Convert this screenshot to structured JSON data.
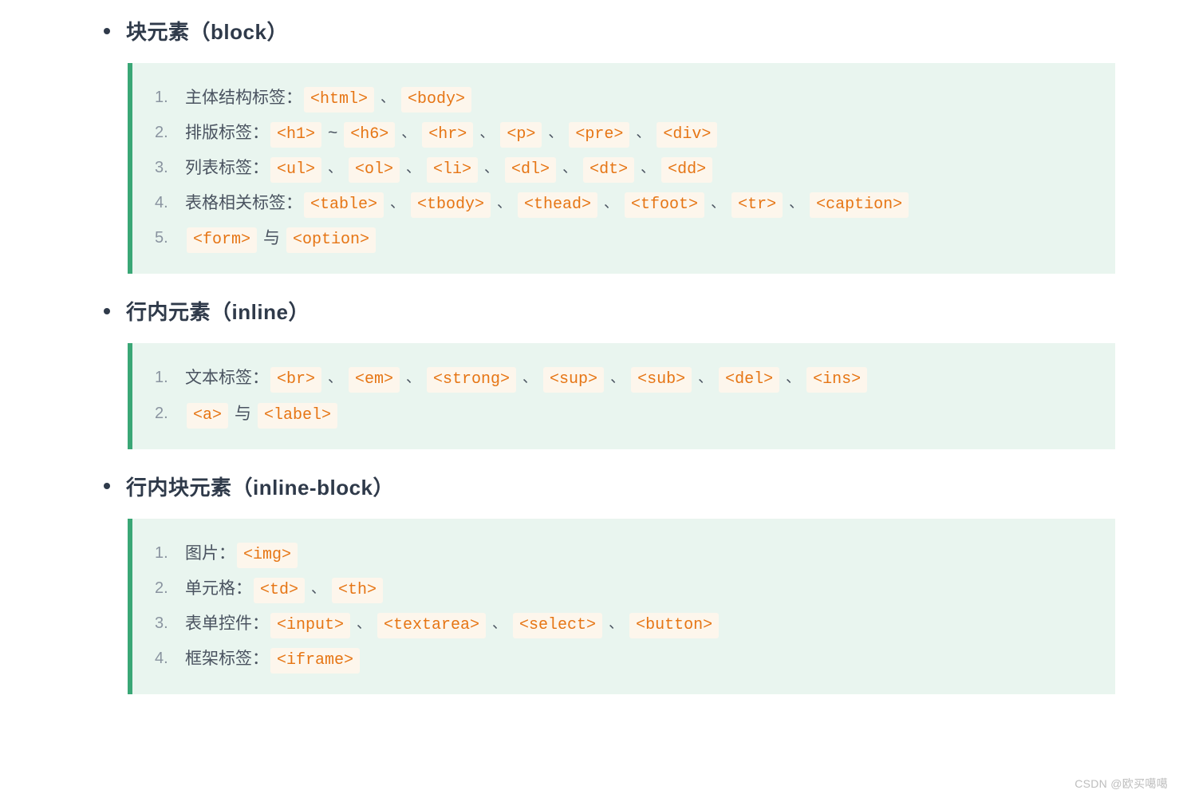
{
  "separators": {
    "dot": "、",
    "tilde": "~",
    "and": "与"
  },
  "sections": [
    {
      "title_cn": "块元素",
      "title_en": "block",
      "items": [
        {
          "label": "主体结构标签：",
          "parts": [
            {
              "code": "<html>"
            },
            {
              "sep": "dot"
            },
            {
              "code": "<body>"
            }
          ]
        },
        {
          "label": "排版标签：",
          "parts": [
            {
              "code": "<h1>"
            },
            {
              "sep": "tilde"
            },
            {
              "code": "<h6>"
            },
            {
              "sep": "dot"
            },
            {
              "code": "<hr>"
            },
            {
              "sep": "dot"
            },
            {
              "code": "<p>"
            },
            {
              "sep": "dot"
            },
            {
              "code": "<pre>"
            },
            {
              "sep": "dot"
            },
            {
              "code": "<div>"
            }
          ]
        },
        {
          "label": "列表标签：",
          "parts": [
            {
              "code": "<ul>"
            },
            {
              "sep": "dot"
            },
            {
              "code": "<ol>"
            },
            {
              "sep": "dot"
            },
            {
              "code": "<li>"
            },
            {
              "sep": "dot"
            },
            {
              "code": "<dl>"
            },
            {
              "sep": "dot"
            },
            {
              "code": "<dt>"
            },
            {
              "sep": "dot"
            },
            {
              "code": "<dd>"
            }
          ]
        },
        {
          "label": "表格相关标签：",
          "parts": [
            {
              "code": "<table>"
            },
            {
              "sep": "dot"
            },
            {
              "code": "<tbody>"
            },
            {
              "sep": "dot"
            },
            {
              "code": "<thead>"
            },
            {
              "sep": "dot"
            },
            {
              "code": "<tfoot>"
            },
            {
              "sep": "dot"
            },
            {
              "code": "<tr>"
            },
            {
              "sep": "dot"
            },
            {
              "code": "<caption>"
            }
          ]
        },
        {
          "label": "",
          "parts": [
            {
              "code": "<form>"
            },
            {
              "sep": "and"
            },
            {
              "code": "<option>"
            }
          ]
        }
      ]
    },
    {
      "title_cn": "行内元素",
      "title_en": "inline",
      "items": [
        {
          "label": "文本标签：",
          "parts": [
            {
              "code": "<br>"
            },
            {
              "sep": "dot"
            },
            {
              "code": "<em>"
            },
            {
              "sep": "dot"
            },
            {
              "code": "<strong>"
            },
            {
              "sep": "dot"
            },
            {
              "code": "<sup>"
            },
            {
              "sep": "dot"
            },
            {
              "code": "<sub>"
            },
            {
              "sep": "dot"
            },
            {
              "code": "<del>"
            },
            {
              "sep": "dot"
            },
            {
              "code": "<ins>"
            }
          ]
        },
        {
          "label": "",
          "parts": [
            {
              "code": "<a>"
            },
            {
              "sep": "and"
            },
            {
              "code": "<label>"
            }
          ]
        }
      ]
    },
    {
      "title_cn": "行内块元素",
      "title_en": "inline-block",
      "items": [
        {
          "label": "图片：",
          "parts": [
            {
              "code": "<img>"
            }
          ]
        },
        {
          "label": "单元格：",
          "parts": [
            {
              "code": "<td>"
            },
            {
              "sep": "dot"
            },
            {
              "code": "<th>"
            }
          ]
        },
        {
          "label": "表单控件：",
          "parts": [
            {
              "code": "<input>"
            },
            {
              "sep": "dot"
            },
            {
              "code": "<textarea>"
            },
            {
              "sep": "dot"
            },
            {
              "code": "<select>"
            },
            {
              "sep": "dot"
            },
            {
              "code": "<button>"
            }
          ]
        },
        {
          "label": "框架标签：",
          "parts": [
            {
              "code": "<iframe>"
            }
          ]
        }
      ]
    }
  ],
  "watermark": "CSDN @欧买噶噶"
}
